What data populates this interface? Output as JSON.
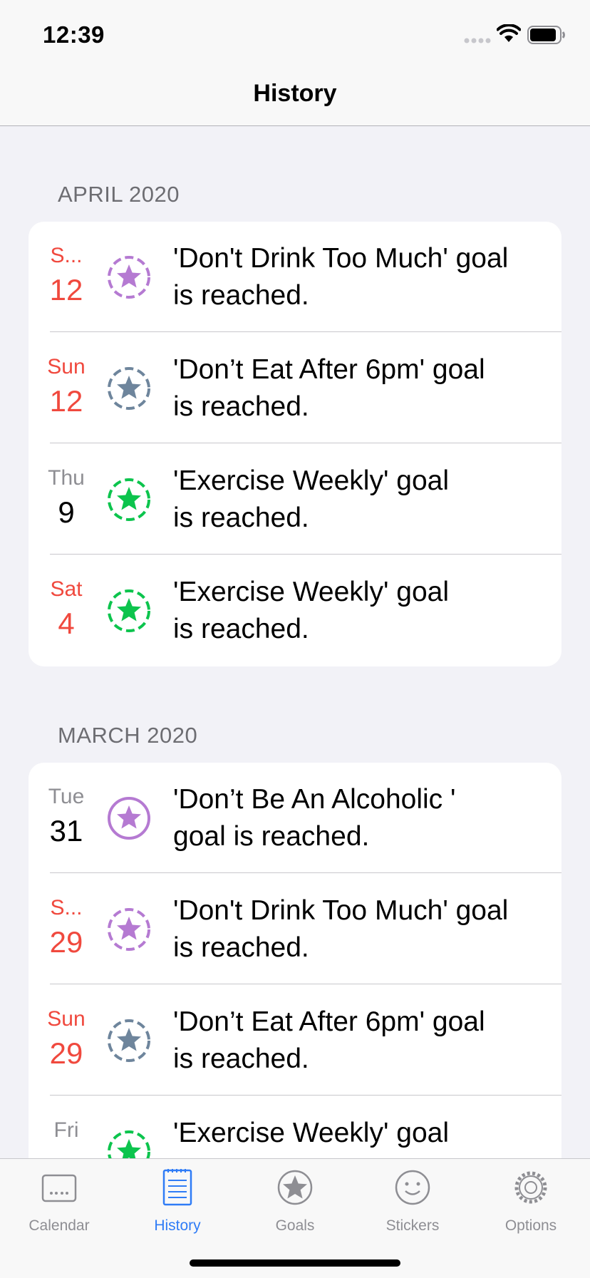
{
  "status": {
    "time": "12:39"
  },
  "nav": {
    "title": "History"
  },
  "colors": {
    "accent": "#2f7cf6",
    "weekend_red": "#f0493e",
    "purple": "#b57ad2",
    "slate": "#6e859c",
    "green": "#0cc44d"
  },
  "sections": [
    {
      "header": "APRIL 2020",
      "rows": [
        {
          "weekday": "S...",
          "day": "12",
          "weekend": true,
          "icon": "star-dashed-purple-icon",
          "color": "#b57ad2",
          "line1": "'Don't Drink Too Much' goal",
          "line2": "is reached."
        },
        {
          "weekday": "Sun",
          "day": "12",
          "weekend": true,
          "icon": "star-dashed-slate-icon",
          "color": "#6e859c",
          "line1": "'Don’t Eat After 6pm' goal",
          "line2": "is reached."
        },
        {
          "weekday": "Thu",
          "day": "9",
          "weekend": false,
          "icon": "star-dashed-green-icon",
          "color": "#0cc44d",
          "line1": "'Exercise Weekly' goal",
          "line2": "is reached."
        },
        {
          "weekday": "Sat",
          "day": "4",
          "weekend": true,
          "icon": "star-dashed-green-icon",
          "color": "#0cc44d",
          "line1": "'Exercise Weekly' goal",
          "line2": "is reached."
        }
      ]
    },
    {
      "header": "MARCH 2020",
      "rows": [
        {
          "weekday": "Tue",
          "day": "31",
          "weekend": false,
          "icon": "star-solid-circle-purple-icon",
          "color": "#b57ad2",
          "line1": "'Don’t Be An Alcoholic '",
          "line2": "goal is reached."
        },
        {
          "weekday": "S...",
          "day": "29",
          "weekend": true,
          "icon": "star-dashed-purple-icon",
          "color": "#b57ad2",
          "line1": "'Don't Drink Too Much' goal",
          "line2": "is reached."
        },
        {
          "weekday": "Sun",
          "day": "29",
          "weekend": true,
          "icon": "star-dashed-slate-icon",
          "color": "#6e859c",
          "line1": "'Don’t Eat After 6pm' goal",
          "line2": "is reached."
        },
        {
          "weekday": "Fri",
          "day": "",
          "weekend": false,
          "icon": "star-dashed-green-icon",
          "color": "#0cc44d",
          "line1": "'Exercise Weekly' goal",
          "line2": ""
        }
      ]
    }
  ],
  "tabs": [
    {
      "label": "Calendar",
      "icon": "calendar-icon",
      "active": false
    },
    {
      "label": "History",
      "icon": "history-list-icon",
      "active": true
    },
    {
      "label": "Goals",
      "icon": "star-circle-icon",
      "active": false
    },
    {
      "label": "Stickers",
      "icon": "smiley-icon",
      "active": false
    },
    {
      "label": "Options",
      "icon": "gear-icon",
      "active": false
    }
  ]
}
